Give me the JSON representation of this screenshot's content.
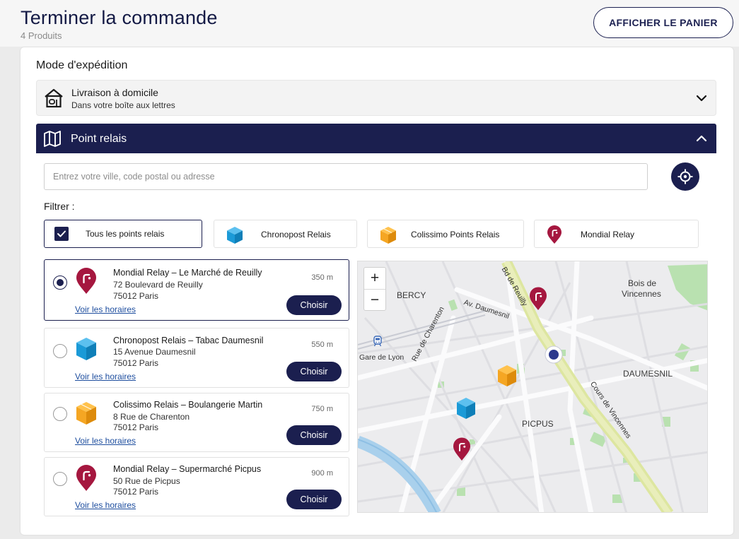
{
  "header": {
    "title": "Terminer la commande",
    "subtitle": "4 Produits",
    "cart_button": "AFFICHER LE PANIER"
  },
  "shipping": {
    "section_title": "Mode d'expédition",
    "home": {
      "title": "Livraison à domicile",
      "subtitle": "Dans votre boîte aux lettres",
      "icon": "home-icon"
    },
    "relay": {
      "title": "Point relais",
      "icon": "map-icon",
      "search_placeholder": "Entrez votre ville, code postal ou adresse",
      "filter_label": "Filtrer :",
      "filters": [
        {
          "label": "Tous les points relais",
          "checked": true
        },
        {
          "label": "Chronopost Relais",
          "icon": "chronopost-cube-icon"
        },
        {
          "label": "Colissimo Points Relais",
          "icon": "colissimo-cube-icon"
        },
        {
          "label": "Mondial Relay",
          "icon": "mondial-relay-pin-icon"
        }
      ],
      "hours_link": "Voir les horaires",
      "choose_label": "Choisir",
      "items": [
        {
          "name": "Mondial Relay – Le Marché de Reuilly",
          "address": "72 Boulevard de Reuilly",
          "city": "75012 Paris",
          "distance": "350 m",
          "carrier": "mondial-relay",
          "selected": true
        },
        {
          "name": "Chronopost Relais – Tabac Daumesnil",
          "address": "15 Avenue Daumesnil",
          "city": "75012 Paris",
          "distance": "550 m",
          "carrier": "chronopost"
        },
        {
          "name": "Colissimo Relais – Boulangerie Martin",
          "address": "8 Rue de Charenton",
          "city": "75012 Paris",
          "distance": "750 m",
          "carrier": "colissimo"
        },
        {
          "name": "Mondial Relay – Supermarché Picpus",
          "address": "50 Rue de Picpus",
          "city": "75012 Paris",
          "distance": "900 m",
          "carrier": "mondial-relay"
        }
      ]
    }
  },
  "map": {
    "zoom_in": "+",
    "zoom_out": "−",
    "labels": {
      "bercy": "BERCY",
      "bois_1": "Bois de",
      "bois_2": "Vincennes",
      "daumesnil": "DAUMESNIL",
      "picpus": "PICPUS",
      "gare": "Gare de Lyon",
      "av_daumesnil": "Av. Daumesnil",
      "rue_charenton": "Rue de Charenton",
      "bd_reuilly": "Bd de Reuilly",
      "cours_vincennes": "Cours de Vincennes"
    }
  },
  "colors": {
    "navy": "#1b1f4f",
    "mondial": "#a5173f",
    "chronopost": "#1b9ad7",
    "colissimo": "#f5a623",
    "link": "#1d4d9e"
  }
}
